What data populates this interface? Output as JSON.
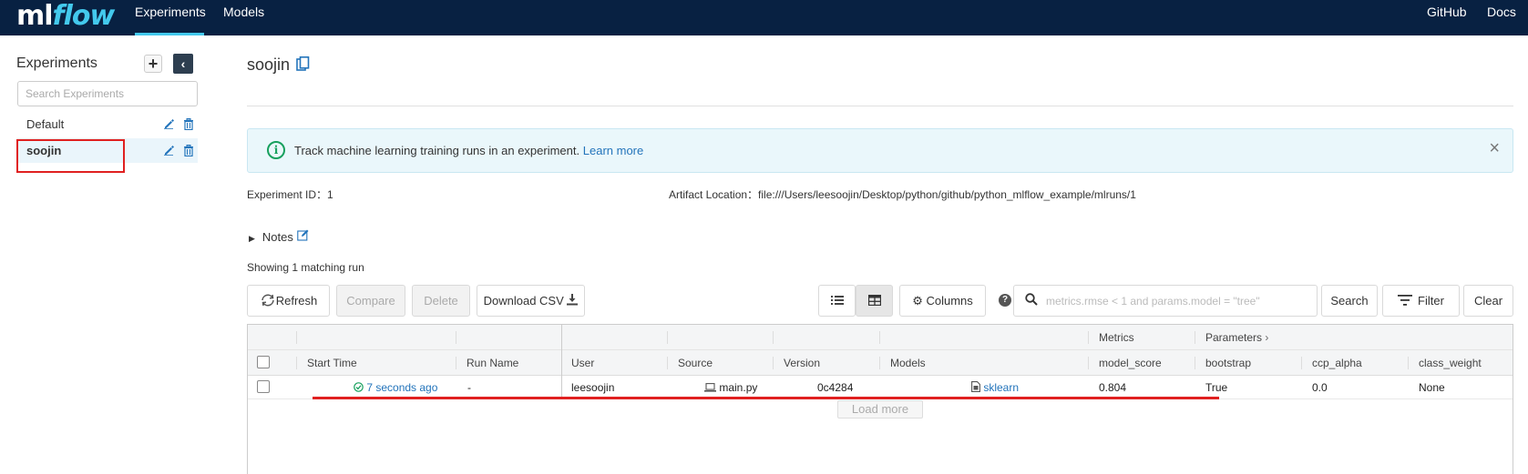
{
  "nav": {
    "logo_ml": "ml",
    "logo_flow": "flow",
    "experiments": "Experiments",
    "models": "Models",
    "github": "GitHub",
    "docs": "Docs"
  },
  "sidebar": {
    "title": "Experiments",
    "add_label": "+",
    "collapse_label": "‹",
    "search_placeholder": "Search Experiments",
    "items": [
      {
        "label": "Default",
        "selected": false
      },
      {
        "label": "soojin",
        "selected": true
      }
    ]
  },
  "main": {
    "title": "soojin",
    "info_text": "Track machine learning training runs in an experiment.",
    "info_link": "Learn more",
    "experiment_id_label": "Experiment ID：",
    "experiment_id": "1",
    "artifact_label": "Artifact Location：",
    "artifact_value": "file:///Users/leesoojin/Desktop/python/github/python_mlflow_example/mlruns/1",
    "notes_label": "Notes",
    "showing": "Showing 1 matching run"
  },
  "toolbar": {
    "refresh": "Refresh",
    "compare": "Compare",
    "delete": "Delete",
    "download_csv": "Download CSV",
    "columns": "Columns",
    "search_placeholder": "metrics.rmse < 1 and params.model = \"tree\"",
    "search": "Search",
    "filter": "Filter",
    "clear": "Clear"
  },
  "table": {
    "group_headers": {
      "metrics": "Metrics",
      "parameters": "Parameters"
    },
    "headers": {
      "start_time": "Start Time",
      "run_name": "Run Name",
      "user": "User",
      "source": "Source",
      "version": "Version",
      "models": "Models",
      "model_score": "model_score",
      "bootstrap": "bootstrap",
      "ccp_alpha": "ccp_alpha",
      "class_weight": "class_weight"
    },
    "rows": [
      {
        "start_time": "7 seconds ago",
        "run_name": "-",
        "user": "leesoojin",
        "source": "main.py",
        "version": "0c4284",
        "models": "sklearn",
        "model_score": "0.804",
        "bootstrap": "True",
        "ccp_alpha": "0.0",
        "class_weight": "None"
      }
    ],
    "load_more": "Load more"
  },
  "colors": {
    "nav_bg": "#082142",
    "accent": "#43c9ed",
    "link": "#2374bb",
    "highlight": "#e02020"
  }
}
